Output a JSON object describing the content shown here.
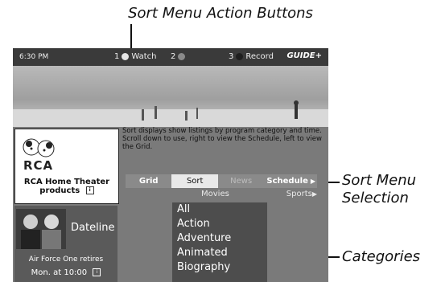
{
  "callouts": {
    "top": "Sort Menu Action Buttons",
    "menu_selection": [
      "Sort Menu",
      "Selection"
    ],
    "categories": "Categories"
  },
  "topbar": {
    "time": "6:30 PM",
    "button1_num": "1",
    "button1_label": "Watch",
    "button2_num": "2",
    "button3_num": "3",
    "button3_label": "Record",
    "logo_text": "GUIDE+"
  },
  "info_text": "Sort displays show listings by program category and time. Scroll down to use, right to view the Schedule, left to view the Grid.",
  "ad1": {
    "brand": "RCA",
    "caption_line1": "RCA Home Theater",
    "caption_line2": "products",
    "badge": "i"
  },
  "ad2": {
    "title": "Dateline",
    "line1": "Air Force One retires",
    "line2": "Mon. at 10:00",
    "badge": "i"
  },
  "tabs": [
    "Grid",
    "Sort",
    "News",
    "Schedule"
  ],
  "category_bar": {
    "current": "Movies",
    "next": "Sports"
  },
  "list_items": [
    "All",
    "Action",
    "Adventure",
    "Animated",
    "Biography"
  ],
  "colors": {
    "dot_watch": "#e6e6e6",
    "dot_unused": "#8a8a8a",
    "dot_record": "#1e1e1e"
  }
}
